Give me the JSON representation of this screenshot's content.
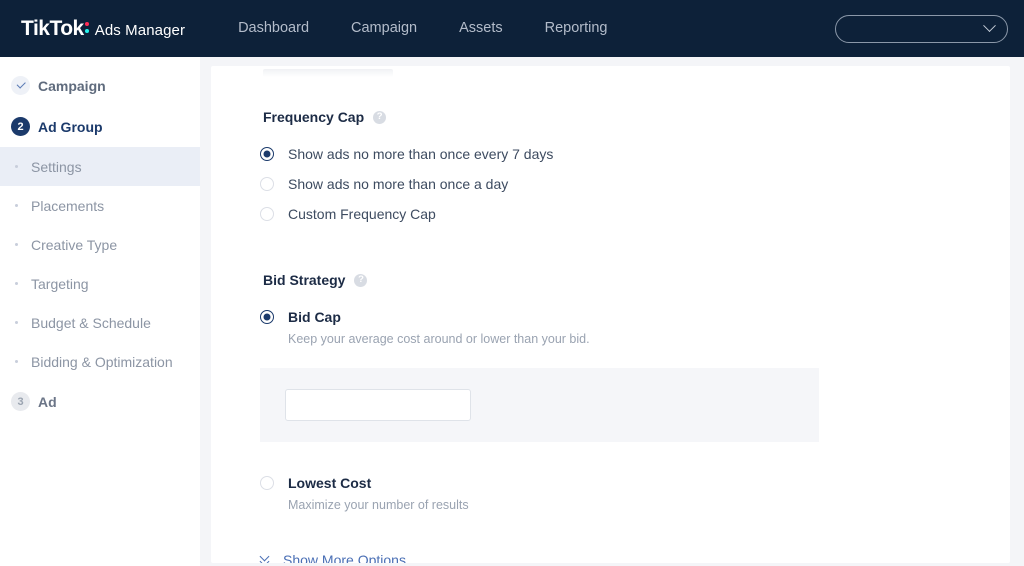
{
  "topnav": {
    "brand": {
      "name": "TikTok",
      "suffix": "Ads Manager",
      "dot_top_color": "#fe2c55",
      "dot_bottom_color": "#25f4ee"
    },
    "links": [
      {
        "label": "Dashboard"
      },
      {
        "label": "Campaign"
      },
      {
        "label": "Assets"
      },
      {
        "label": "Reporting"
      }
    ],
    "account_selector": {
      "value": "",
      "icon": "chevron-down-icon"
    },
    "background_color": "#0d2139"
  },
  "sidebar": {
    "steps": [
      {
        "id": "campaign",
        "label": "Campaign",
        "badge": "check-icon",
        "state": "done"
      },
      {
        "id": "ad-group",
        "label": "Ad Group",
        "badge": "2",
        "state": "active"
      }
    ],
    "substeps": [
      {
        "id": "settings",
        "label": "Settings",
        "selected": true
      },
      {
        "id": "placements",
        "label": "Placements",
        "selected": false
      },
      {
        "id": "creative-type",
        "label": "Creative Type",
        "selected": false
      },
      {
        "id": "targeting",
        "label": "Targeting",
        "selected": false
      },
      {
        "id": "budget-schedule",
        "label": "Budget & Schedule",
        "selected": false
      },
      {
        "id": "bidding-optimization",
        "label": "Bidding & Optimization",
        "selected": false
      }
    ],
    "last_step": {
      "id": "ad",
      "label": "Ad",
      "badge": "3",
      "state": "pending"
    },
    "selected_color": "#eaeef6",
    "active_badge_color": "#1b3a6b"
  },
  "main": {
    "frequency_cap": {
      "title": "Frequency Cap",
      "help_icon": "?",
      "options": [
        {
          "label": "Show ads no more than once every 7 days",
          "checked": true
        },
        {
          "label": "Show ads no more than once a day",
          "checked": false
        },
        {
          "label": "Custom Frequency Cap",
          "checked": false
        }
      ]
    },
    "bid_strategy": {
      "title": "Bid Strategy",
      "help_icon": "?",
      "options": [
        {
          "label": "Bid Cap",
          "description": "Keep your average cost around or lower than your bid.",
          "checked": true
        },
        {
          "label": "Lowest Cost",
          "description": "Maximize your number of results",
          "checked": false
        }
      ],
      "bid_input": {
        "value": "",
        "placeholder": ""
      }
    },
    "show_more": {
      "label": "Show More Options",
      "icon": "double-chevron-down-icon",
      "color": "#4a6fb5"
    }
  }
}
